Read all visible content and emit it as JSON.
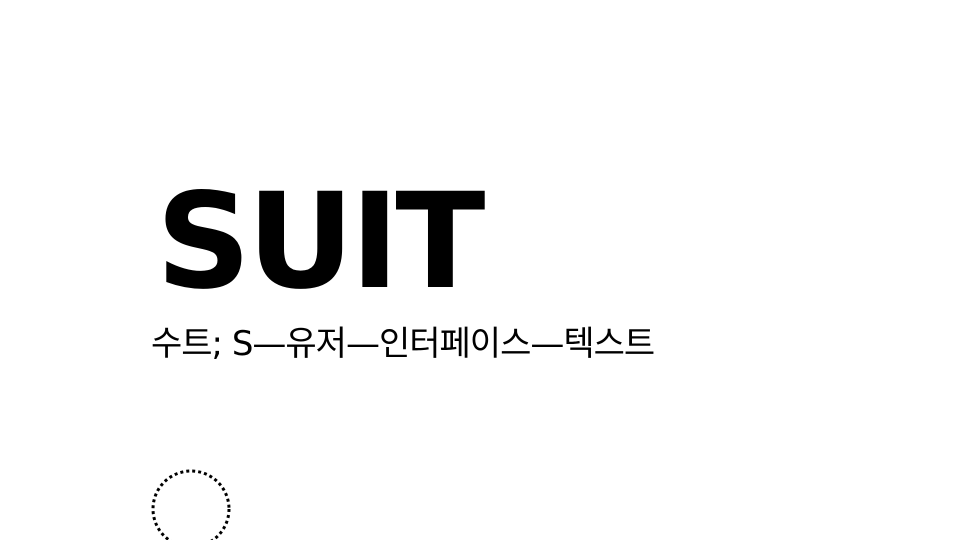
{
  "title": "SUIT",
  "subtitle": "수트; S—유저—인터페이스—텍스트",
  "colors": {
    "background": "#ffffff",
    "text": "#000000"
  },
  "icons": {
    "decoration": "dotted-circle-icon"
  }
}
